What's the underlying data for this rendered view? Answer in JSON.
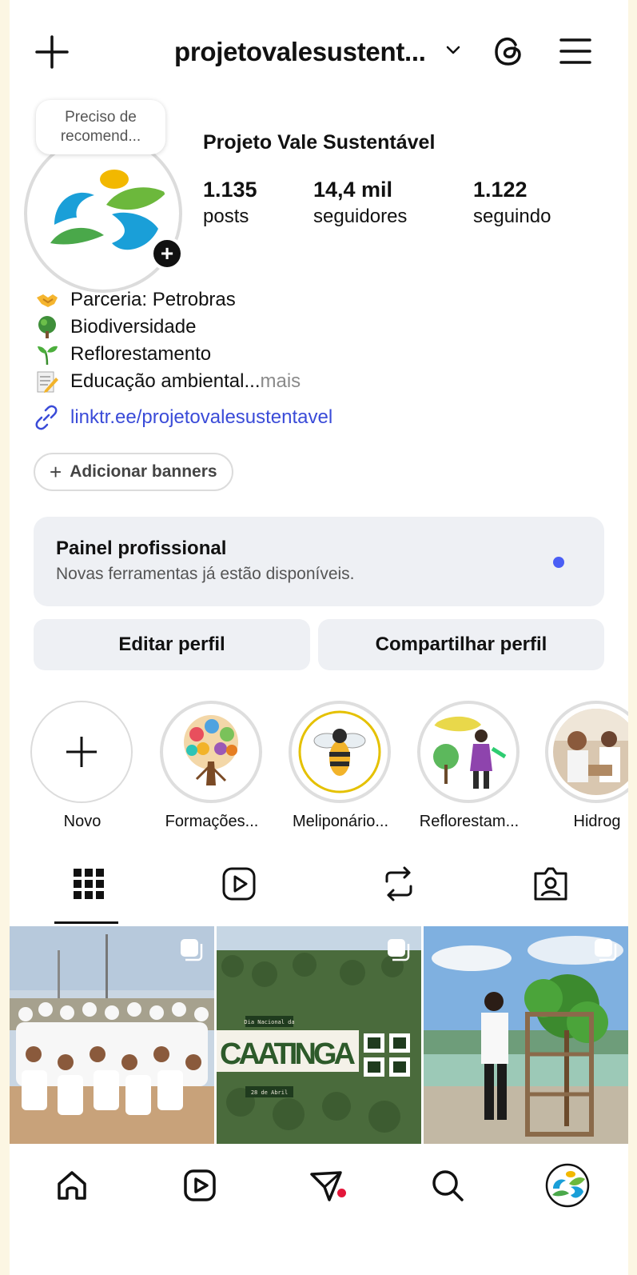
{
  "header": {
    "username": "projetovalesustent...",
    "icons": [
      "plus-icon",
      "chevron-down-icon",
      "threads-icon",
      "menu-icon"
    ]
  },
  "profile": {
    "note": "Preciso de recomend...",
    "display_name": "Projeto Vale Sustentável",
    "stats": [
      {
        "value": "1.135",
        "label": "posts"
      },
      {
        "value": "14,4 mil",
        "label": "seguidores"
      },
      {
        "value": "1.122",
        "label": "seguindo"
      }
    ]
  },
  "bio": {
    "lines": [
      {
        "emoji": "handshake",
        "text": "Parceria: Petrobras"
      },
      {
        "emoji": "tree",
        "text": "Biodiversidade"
      },
      {
        "emoji": "seedling",
        "text": "Reflorestamento"
      },
      {
        "emoji": "memo",
        "text": "Educação ambiental..."
      }
    ],
    "more": " mais",
    "link": "linktr.ee/projetovalesustentavel"
  },
  "banners": {
    "label": "Adicionar banners"
  },
  "panel": {
    "title": "Painel profissional",
    "subtitle": "Novas ferramentas já estão disponíveis."
  },
  "actions": {
    "edit": "Editar perfil",
    "share": "Compartilhar perfil"
  },
  "highlights": [
    {
      "label": "Novo"
    },
    {
      "label": "Formações..."
    },
    {
      "label": "Meliponário..."
    },
    {
      "label": "Reflorestam..."
    },
    {
      "label": "Hidrog"
    }
  ],
  "posts": [
    {
      "overlay_title": "",
      "overlay_top": "",
      "overlay_bottom": ""
    },
    {
      "overlay_title": "CAATINGA",
      "overlay_top": "Dia Nacional da",
      "overlay_bottom": "28 de Abril"
    },
    {
      "overlay_title": "",
      "overlay_top": "",
      "overlay_bottom": ""
    }
  ],
  "colors": {
    "accent_link": "#3a4bd8",
    "panel_bg": "#eef0f4",
    "notif": "#e3173a",
    "page_bg": "#fcf6e3"
  }
}
